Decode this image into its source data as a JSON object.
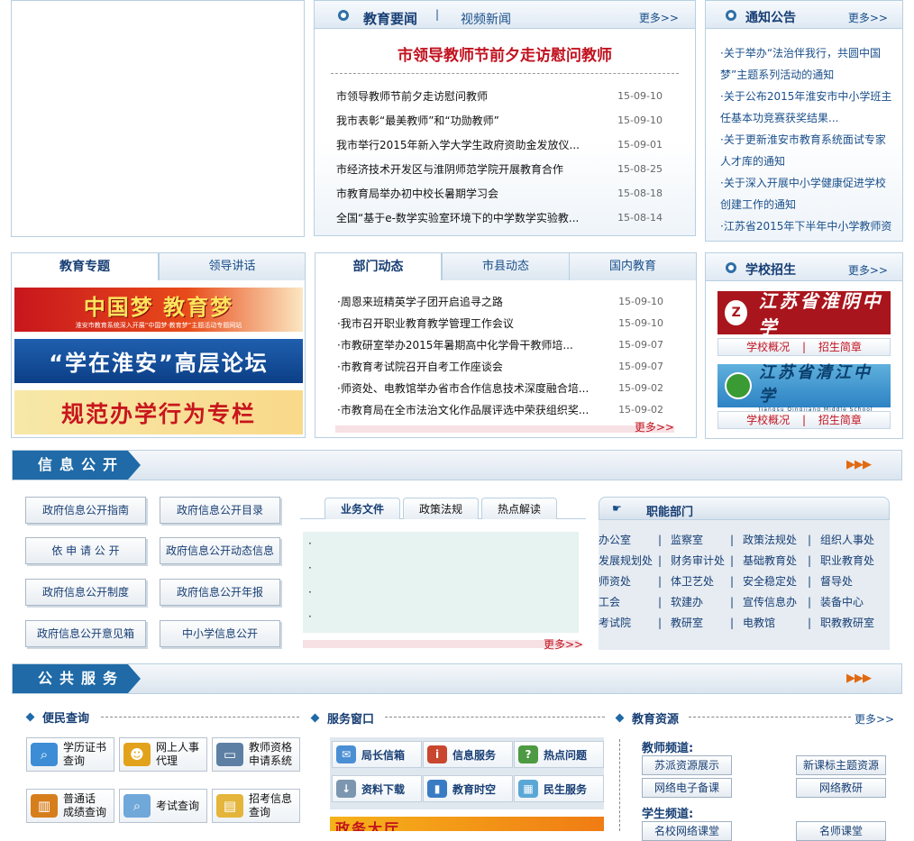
{
  "news": {
    "tabs": [
      "教育要闻",
      "视频新闻"
    ],
    "more": "更多>>",
    "headline": "市领导教师节前夕走访慰问教师",
    "items": [
      {
        "title": "市领导教师节前夕走访慰问教师",
        "date": "15-09-10"
      },
      {
        "title": "我市表彰“最美教师”和“功勋教师”",
        "date": "15-09-10"
      },
      {
        "title": "我市举行2015年新入学大学生政府资助金发放仪...",
        "date": "15-09-01"
      },
      {
        "title": "市经济技术开发区与淮阴师范学院开展教育合作",
        "date": "15-08-25"
      },
      {
        "title": "市教育局举办初中校长暑期学习会",
        "date": "15-08-18"
      },
      {
        "title": "全国“基于e-数学实验室环境下的中学数学实验教...",
        "date": "15-08-14"
      }
    ]
  },
  "notice": {
    "title": "通知公告",
    "more": "更多>>",
    "items": [
      "·关于举办“法治伴我行，共圆中国梦”主题系列活动的通知",
      "·关于公布2015年淮安市中小学班主任基本功竞赛获奖结果...",
      "·关于更新淮安市教育系统面试专家人才库的通知",
      "·关于深入开展中小学健康促进学校创建工作的通知",
      "·江苏省2015年下半年中小学教师资"
    ]
  },
  "topic": {
    "tabs": [
      "教育专题",
      "领导讲话"
    ],
    "banners": [
      {
        "text": "中国梦 教育梦",
        "sub": "淮安市教育系统深入开展“中国梦·教育梦”主题活动专题网站"
      },
      {
        "text": "“学在淮安”高层论坛"
      },
      {
        "text": "规范办学行为专栏"
      }
    ]
  },
  "dept": {
    "tabs": [
      "部门动态",
      "市县动态",
      "国内教育"
    ],
    "more": "更多>>",
    "items": [
      {
        "title": "·周恩来班精英学子团开启追寻之路",
        "date": "15-09-10"
      },
      {
        "title": "·我市召开职业教育教学管理工作会议",
        "date": "15-09-10"
      },
      {
        "title": "·市教研室举办2015年暑期高中化学骨干教师培...",
        "date": "15-09-07"
      },
      {
        "title": "·市教育考试院召开自考工作座谈会",
        "date": "15-09-07"
      },
      {
        "title": "·师资处、电教馆举办省市合作信息技术深度融合培...",
        "date": "15-09-02"
      },
      {
        "title": "·市教育局在全市法治文化作品展评选中荣获组织奖...",
        "date": "15-09-02"
      }
    ]
  },
  "admission": {
    "title": "学校招生",
    "more": "更多>>",
    "schools": [
      {
        "name": "江苏省淮阴中学",
        "links": [
          "学校概况",
          "招生简章"
        ],
        "sep": "|"
      },
      {
        "name": "江苏省清江中学",
        "sub": "Jiangsu Qingjiang Middle School",
        "links": [
          "学校概况",
          "招生简章"
        ],
        "sep": "|"
      }
    ]
  },
  "info": {
    "bar_label": "信息公开",
    "arrows": "▶▶▶",
    "buttons": [
      "政府信息公开指南",
      "政府信息公开目录",
      "依 申 请 公 开",
      "政府信息公开动态信息",
      "政府信息公开制度",
      "政府信息公开年报",
      "政府信息公开意见箱",
      "中小学信息公开"
    ],
    "file_tabs": [
      "业务文件",
      "政策法规",
      "热点解读"
    ],
    "file_items": [
      "·",
      "·",
      "·",
      "·"
    ],
    "more": "更多>>",
    "depts_title": "职能部门",
    "sep": "|",
    "depts": [
      [
        "办公室",
        "监察室",
        "政策法规处",
        "组织人事处"
      ],
      [
        "发展规划处",
        "财务审计处",
        "基础教育处",
        "职业教育处"
      ],
      [
        "师资处",
        "体卫艺处",
        "安全稳定处",
        "督导处"
      ],
      [
        "工会",
        "软建办",
        "宣传信息办",
        "装备中心"
      ],
      [
        "考试院",
        "教研室",
        "电教馆",
        "职教教研室"
      ]
    ]
  },
  "service": {
    "bar_label": "公共服务",
    "arrows": "▶▶▶",
    "citizen_title": "便民查询",
    "citizen": [
      {
        "l1": "学历证书",
        "l2": "查询",
        "icon": "magnifier-icon"
      },
      {
        "l1": "网上人事",
        "l2": "代理",
        "icon": "person-icon"
      },
      {
        "l1": "教师资格",
        "l2": "申请系统",
        "icon": "monitor-icon"
      },
      {
        "l1": "普通话",
        "l2": "成绩查询",
        "icon": "books-icon"
      },
      {
        "l1": "考试查询",
        "l2": "",
        "icon": "search-doc-icon"
      },
      {
        "l1": "招考信息",
        "l2": "查询",
        "icon": "notice-icon"
      }
    ],
    "window_title": "服务窗口",
    "windows": [
      {
        "label": "局长信箱",
        "icon": "mail-icon"
      },
      {
        "label": "信息服务",
        "icon": "info-icon"
      },
      {
        "label": "热点问题",
        "icon": "question-icon"
      },
      {
        "label": "资料下载",
        "icon": "download-icon"
      },
      {
        "label": "教育时空",
        "icon": "chart-icon"
      },
      {
        "label": "民生服务",
        "icon": "service-icon"
      }
    ],
    "hall_text": "政务大厅",
    "resource_title": "教育资源",
    "resource_more": "更多>>",
    "teacher_channel": "教师频道:",
    "teacher_links": [
      "苏派资源展示",
      "新课标主题资源",
      "网络电子备课",
      "网络教研"
    ],
    "student_channel": "学生频道:",
    "student_links": [
      "名校网络课堂",
      "名师课堂"
    ]
  }
}
